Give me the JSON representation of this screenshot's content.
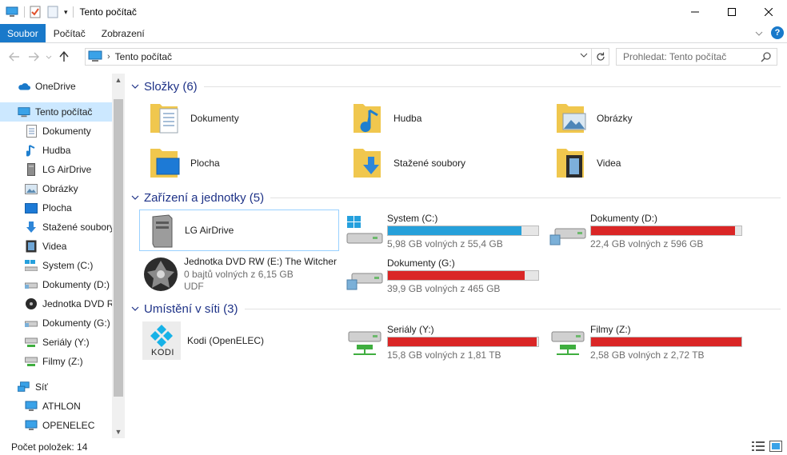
{
  "window": {
    "title": "Tento počítač"
  },
  "ribbon": {
    "tabs": [
      "Soubor",
      "Počítač",
      "Zobrazení"
    ]
  },
  "address": {
    "path": "Tento počítač",
    "search_placeholder": "Prohledat: Tento počítač"
  },
  "sidebar": {
    "items": [
      {
        "label": "OneDrive",
        "icon": "onedrive-icon"
      },
      {
        "label": "Tento počítač",
        "icon": "computer-icon",
        "selected": true
      },
      {
        "label": "Dokumenty",
        "icon": "document-icon"
      },
      {
        "label": "Hudba",
        "icon": "music-icon"
      },
      {
        "label": "LG AirDrive",
        "icon": "drive-icon"
      },
      {
        "label": "Obrázky",
        "icon": "pictures-icon"
      },
      {
        "label": "Plocha",
        "icon": "desktop-icon"
      },
      {
        "label": "Stažené soubory",
        "icon": "downloads-icon"
      },
      {
        "label": "Videa",
        "icon": "video-icon"
      },
      {
        "label": "System (C:)",
        "icon": "windows-drive-icon"
      },
      {
        "label": "Dokumenty (D:)",
        "icon": "hdd-icon"
      },
      {
        "label": "Jednotka DVD RW",
        "icon": "dvd-icon"
      },
      {
        "label": "Dokumenty (G:)",
        "icon": "hdd-icon"
      },
      {
        "label": "Seriály (Y:)",
        "icon": "network-drive-icon"
      },
      {
        "label": "Filmy (Z:)",
        "icon": "network-drive-icon"
      },
      {
        "label": "Síť",
        "icon": "network-icon"
      },
      {
        "label": "ATHLON",
        "icon": "computer-icon"
      },
      {
        "label": "OPENELEC",
        "icon": "computer-icon"
      }
    ]
  },
  "groups": {
    "folders": "Složky (6)",
    "devices": "Zařízení a jednotky (5)",
    "network": "Umístění v síti (3)"
  },
  "folders": [
    {
      "label": "Dokumenty",
      "icon": "documents-folder-icon"
    },
    {
      "label": "Hudba",
      "icon": "music-folder-icon"
    },
    {
      "label": "Obrázky",
      "icon": "pictures-folder-icon"
    },
    {
      "label": "Plocha",
      "icon": "desktop-folder-icon"
    },
    {
      "label": "Stažené soubory",
      "icon": "downloads-folder-icon"
    },
    {
      "label": "Videa",
      "icon": "videos-folder-icon"
    }
  ],
  "devices": {
    "airdrive": {
      "label": "LG AirDrive"
    },
    "dvd": {
      "name": "Jednotka DVD RW (E:) The Witcher",
      "free": "0 bajtů volných z 6,15 GB",
      "fs": "UDF"
    },
    "drives": [
      {
        "name": "System (C:)",
        "free": "5,98 GB volných z 55,4 GB",
        "used_fraction": 0.89,
        "color": "#26a0da"
      },
      {
        "name": "Dokumenty (D:)",
        "free": "22,4 GB volných z 596 GB",
        "used_fraction": 0.96,
        "color": "#da2626"
      },
      {
        "name": "Dokumenty (G:)",
        "free": "39,9 GB volných z 465 GB",
        "used_fraction": 0.91,
        "color": "#da2626"
      }
    ]
  },
  "network": {
    "kodi": {
      "label": "Kodi (OpenELEC)",
      "logo_text": "KODI"
    },
    "drives": [
      {
        "name": "Seriály (Y:)",
        "free": "15,8 GB volných z 1,81 TB",
        "used_fraction": 0.99,
        "color": "#da2626"
      },
      {
        "name": "Filmy (Z:)",
        "free": "2,58 GB volných z 2,72 TB",
        "used_fraction": 0.999,
        "color": "#da2626"
      }
    ]
  },
  "status": {
    "count": "Počet položek: 14"
  }
}
